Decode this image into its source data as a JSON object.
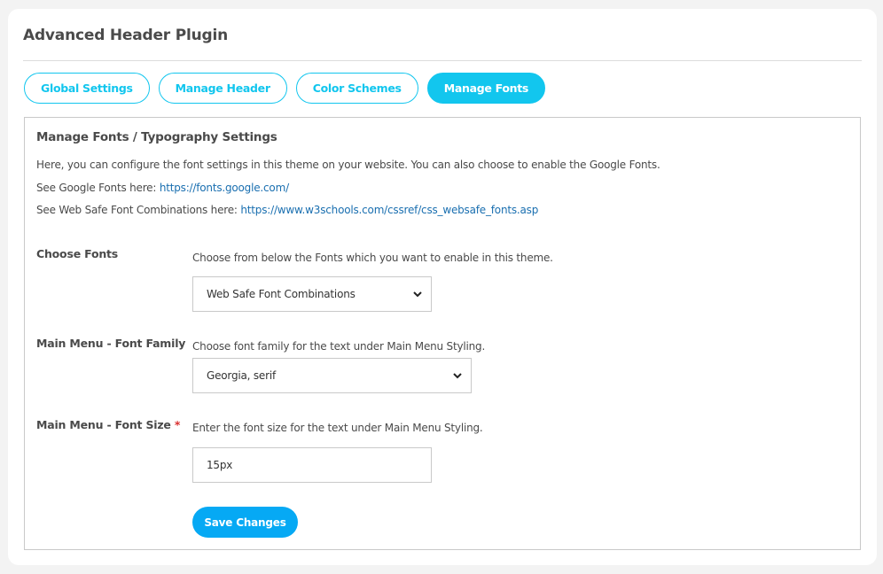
{
  "app": {
    "title": "Advanced Header Plugin"
  },
  "tabs": [
    {
      "label": "Global Settings",
      "active": false
    },
    {
      "label": "Manage Header",
      "active": false
    },
    {
      "label": "Color Schemes",
      "active": false
    },
    {
      "label": "Manage Fonts",
      "active": true
    }
  ],
  "panel": {
    "title": "Manage Fonts / Typography Settings",
    "intro": "Here, you can configure the font settings in this theme on your website. You can also choose to enable the Google Fonts.",
    "google_fonts_prefix": "See Google Fonts here: ",
    "google_fonts_link": "https://fonts.google.com/",
    "websafe_prefix": "See Web Safe Font Combinations here: ",
    "websafe_link": "https://www.w3schools.com/cssref/css_websafe_fonts.asp"
  },
  "fields": {
    "choose_fonts": {
      "label": "Choose Fonts",
      "help": "Choose from below the Fonts which you want to enable in this theme.",
      "value": "Web Safe Font Combinations"
    },
    "font_family": {
      "label": "Main Menu - Font Family",
      "help": "Choose font family for the text under Main Menu Styling.",
      "value": "Georgia, serif"
    },
    "font_size": {
      "label": "Main Menu - Font Size",
      "required_mark": "*",
      "help": "Enter the font size for the text under Main Menu Styling.",
      "value": "15px"
    }
  },
  "actions": {
    "save_label": "Save Changes"
  },
  "colors": {
    "accent": "#12c6ee",
    "save_button": "#06a9f4",
    "link": "#1a6fb0",
    "required": "#d93030"
  }
}
